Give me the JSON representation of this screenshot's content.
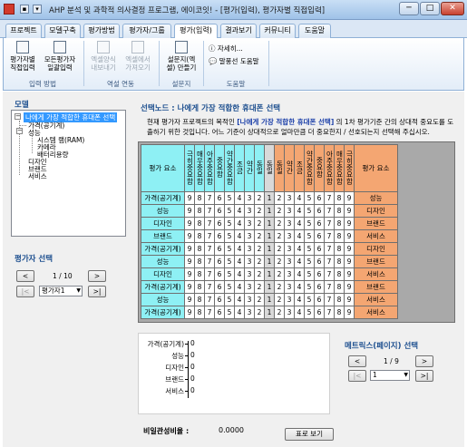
{
  "window": {
    "title": "AHP 분석 및 과학적 의사결정 프로그램, 에이코잇! - [평가(입력), 평가자별 직접입력]",
    "minimize": "─",
    "maximize": "□",
    "close": "✕"
  },
  "tabs": [
    "프로젝트",
    "모델구축",
    "평가방법",
    "평가자/그룹",
    "평가(입력)",
    "결과보기",
    "커뮤니티",
    "도움말"
  ],
  "active_tab": "평가(입력)",
  "ribbon": {
    "input_group": {
      "label": "입력 방법",
      "buttons": [
        "평가자별 직접입력",
        "모든평가자 일괄입력"
      ]
    },
    "survey_group": {
      "label": "역설 연동",
      "buttons": [
        "엑셀양식 내보내기",
        "엑셀에서 가져오기"
      ]
    },
    "form_group": {
      "label": "설문지",
      "buttons": [
        "설문지(엑셀) 만들기"
      ]
    },
    "help_group": {
      "label": "도움말",
      "items": [
        "자세히...",
        "말풍선 도움말"
      ]
    }
  },
  "model": {
    "title": "모델",
    "tree": {
      "root": "나에게 가장 적합한 휴대폰 선택",
      "children": [
        "가격(공기계)",
        "성능",
        "시스템 램(RAM)",
        "카메라",
        "배터리용량",
        "디자인",
        "브랜드",
        "서비스"
      ]
    }
  },
  "evaluator": {
    "title": "평가자 선택",
    "page": "1 / 10",
    "selected": "평가자1",
    "prev": "<",
    "next": ">",
    "first": "|<",
    "last": ">|"
  },
  "main": {
    "title": "선택노드 : 나에게 가장 적합한 휴대폰 선택",
    "desc_prefix": "현재 평가자 프로젝트의 목적인",
    "desc_highlight": "[나에게 가장 적합한 휴대폰 선택]",
    "desc_suffix": "의 1차 평가기준 간의 상대적 중요도를 도출하기 위한 것입니다. 어느 기준이 상대적으로 얼마만큼 더 중요한지 / 선호되는지 선택해 주십시오."
  },
  "grid": {
    "left_header": "평가 요소",
    "right_header": "평가 요소",
    "left_scale_labels": [
      "극히중요함",
      "매우중요함",
      "아주중요함",
      "중요함",
      "약간중요함",
      "조금",
      "약간",
      "동일"
    ],
    "center_label": "동일",
    "right_scale_labels": [
      "동일",
      "약간",
      "조금",
      "약간중요함",
      "중요함",
      "아주중요함",
      "매우중요함",
      "극히중요함"
    ],
    "scale_values_left": [
      "9",
      "8",
      "7",
      "6",
      "5",
      "4",
      "3",
      "2"
    ],
    "center_value": "1",
    "scale_values_right": [
      "2",
      "3",
      "4",
      "5",
      "6",
      "7",
      "8",
      "9"
    ],
    "rows": [
      {
        "left": "가격(공기계)",
        "right": "성능"
      },
      {
        "left": "성능",
        "right": "디자인"
      },
      {
        "left": "디자인",
        "right": "브랜드"
      },
      {
        "left": "브랜드",
        "right": "서비스"
      },
      {
        "left": "가격(공기계)",
        "right": "디자인"
      },
      {
        "left": "성능",
        "right": "브랜드"
      },
      {
        "left": "디자인",
        "right": "서비스"
      },
      {
        "left": "가격(공기계)",
        "right": "브랜드"
      },
      {
        "left": "성능",
        "right": "서비스"
      },
      {
        "left": "가격(공기계)",
        "right": "서비스"
      }
    ],
    "colors": {
      "left": "#8ef0f4",
      "right": "#f4a672",
      "center": "#d9d9d9"
    }
  },
  "weights": {
    "items": [
      {
        "label": "가격(공기계)",
        "value": "0"
      },
      {
        "label": "성능",
        "value": "0"
      },
      {
        "label": "디자인",
        "value": "0"
      },
      {
        "label": "브랜드",
        "value": "0"
      },
      {
        "label": "서비스",
        "value": "0"
      }
    ]
  },
  "matrix": {
    "title": "메트릭스(페이지) 선택",
    "page": "1 / 9",
    "selected": "1",
    "prev": "<",
    "next": ">",
    "first": "|<",
    "last": ">|"
  },
  "consistency": {
    "label": "비일관성비율 :",
    "value": "0.0000",
    "button": "표로 보기"
  }
}
